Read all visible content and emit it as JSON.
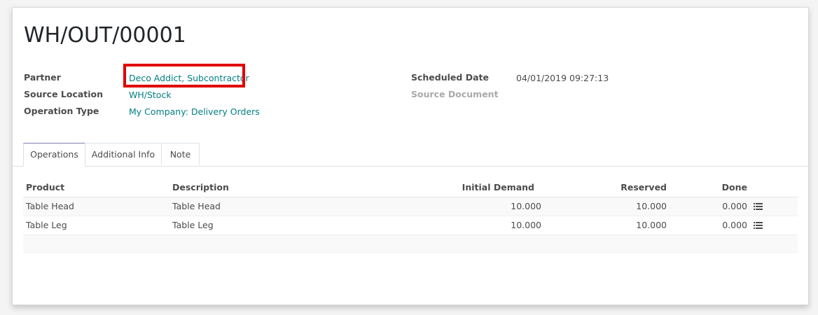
{
  "record": {
    "title": "WH/OUT/00001"
  },
  "fields": {
    "partner": {
      "label": "Partner",
      "value": "Deco Addict, Subcontractor"
    },
    "source_location": {
      "label": "Source Location",
      "value": "WH/Stock"
    },
    "operation_type": {
      "label": "Operation Type",
      "value": "My Company: Delivery Orders"
    },
    "scheduled_date": {
      "label": "Scheduled Date",
      "value": "04/01/2019 09:27:13"
    },
    "source_document": {
      "label": "Source Document",
      "value": ""
    }
  },
  "tabs": [
    {
      "label": "Operations",
      "active": true
    },
    {
      "label": "Additional Info",
      "active": false
    },
    {
      "label": "Note",
      "active": false
    }
  ],
  "table": {
    "headers": {
      "product": "Product",
      "description": "Description",
      "initial_demand": "Initial Demand",
      "reserved": "Reserved",
      "done": "Done"
    },
    "rows": [
      {
        "product": "Table Head",
        "description": "Table Head",
        "initial_demand": "10.000",
        "reserved": "10.000",
        "done": "0.000"
      },
      {
        "product": "Table Leg",
        "description": "Table Leg",
        "initial_demand": "10.000",
        "reserved": "10.000",
        "done": "0.000"
      }
    ]
  },
  "colors": {
    "link": "#017e84",
    "highlight": "#e00000",
    "active_tab_accent": "#7c7bad"
  },
  "icons": {
    "row_detail": "list-icon"
  }
}
